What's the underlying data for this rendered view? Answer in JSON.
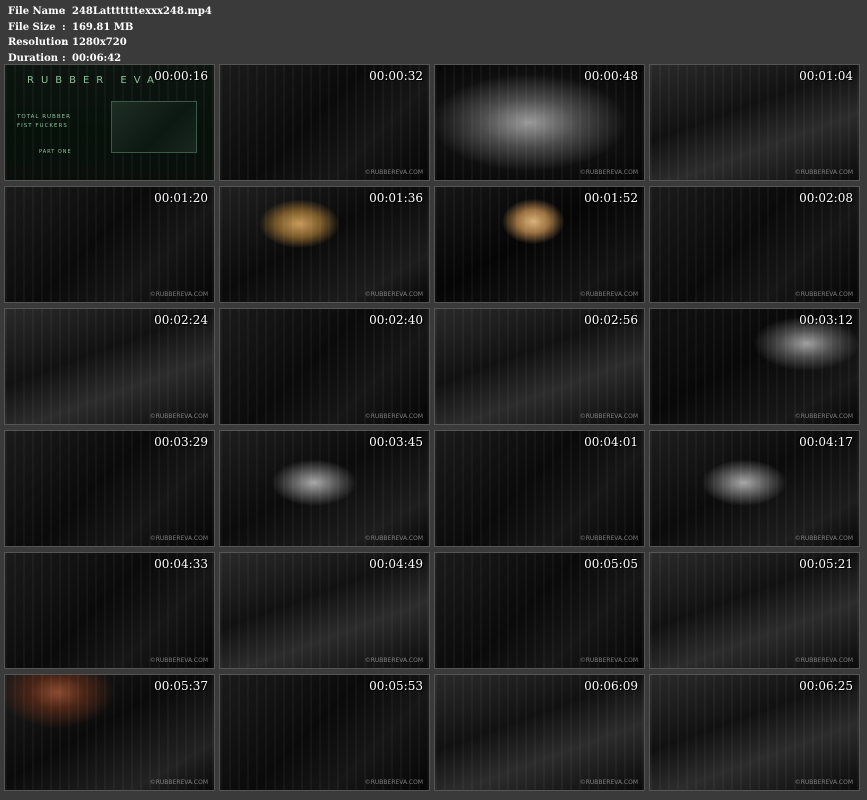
{
  "file_info": [
    {
      "label": "File Name",
      "value": "248Latttttttexxx248.mp4"
    },
    {
      "label": "File Size",
      "value": "169.81 MB"
    },
    {
      "label": "Resolution",
      "value": "1280x720"
    },
    {
      "label": "Duration",
      "value": "00:06:42"
    }
  ],
  "separator": ":",
  "title_card": {
    "logo": "RUBBER EVA",
    "lines": [
      "TOTAL RUBBER",
      "FIST FUCKERS"
    ],
    "part": "PART ONE"
  },
  "watermark": "©RUBBEREVA.COM",
  "thumbnails": [
    {
      "time": "00:00:16",
      "style": "title"
    },
    {
      "time": "00:00:32",
      "style": "dark"
    },
    {
      "time": "00:00:48",
      "style": "light"
    },
    {
      "time": "00:01:04",
      "style": "mid"
    },
    {
      "time": "00:01:20",
      "style": "dark"
    },
    {
      "time": "00:01:36",
      "style": "face"
    },
    {
      "time": "00:01:52",
      "style": "face2"
    },
    {
      "time": "00:02:08",
      "style": "dark"
    },
    {
      "time": "00:02:24",
      "style": "mid"
    },
    {
      "time": "00:02:40",
      "style": "dark"
    },
    {
      "time": "00:02:56",
      "style": "mid"
    },
    {
      "time": "00:03:12",
      "style": "pale2"
    },
    {
      "time": "00:03:29",
      "style": "dark"
    },
    {
      "time": "00:03:45",
      "style": "pale"
    },
    {
      "time": "00:04:01",
      "style": "dark"
    },
    {
      "time": "00:04:17",
      "style": "pale"
    },
    {
      "time": "00:04:33",
      "style": "dark"
    },
    {
      "time": "00:04:49",
      "style": "mid"
    },
    {
      "time": "00:05:05",
      "style": "dark"
    },
    {
      "time": "00:05:21",
      "style": "mid"
    },
    {
      "time": "00:05:37",
      "style": "red"
    },
    {
      "time": "00:05:53",
      "style": "dark"
    },
    {
      "time": "00:06:09",
      "style": "mid"
    },
    {
      "time": "00:06:25",
      "style": "mid"
    }
  ]
}
